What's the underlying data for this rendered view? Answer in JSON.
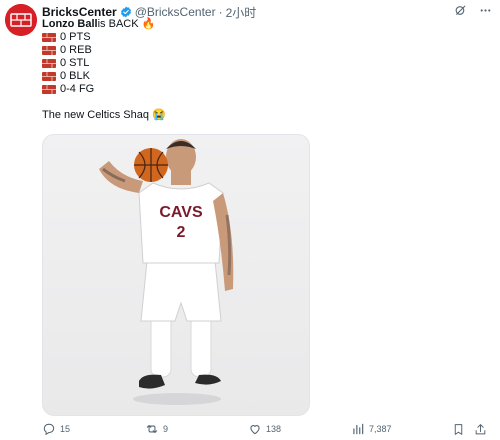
{
  "author": {
    "display_name": "BricksCenter",
    "handle": "@BricksCenter",
    "separator": "·",
    "time": "2小时"
  },
  "tweet": {
    "lines": [
      {
        "bold": "Lonzo Ball",
        "rest": " is BACK 🔥"
      },
      {
        "icon": "brick-icon",
        "text": "0 PTS"
      },
      {
        "icon": "brick-icon",
        "text": "0 REB"
      },
      {
        "icon": "brick-icon",
        "text": "0 STL"
      },
      {
        "icon": "brick-icon",
        "text": "0 BLK"
      },
      {
        "icon": "brick-icon",
        "text": "0-4 FG"
      },
      {
        "text": ""
      },
      {
        "text": "The new Celtics Shaq 😭"
      }
    ]
  },
  "photo": {
    "jersey_team": "CAVS",
    "jersey_number": "2"
  },
  "actions": {
    "reply_count": "15",
    "retweet_count": "9",
    "like_count": "138",
    "view_count": "7,387"
  },
  "colors": {
    "brand_red": "#d71f26",
    "verified_blue": "#1d9bf0",
    "muted": "#536471"
  }
}
